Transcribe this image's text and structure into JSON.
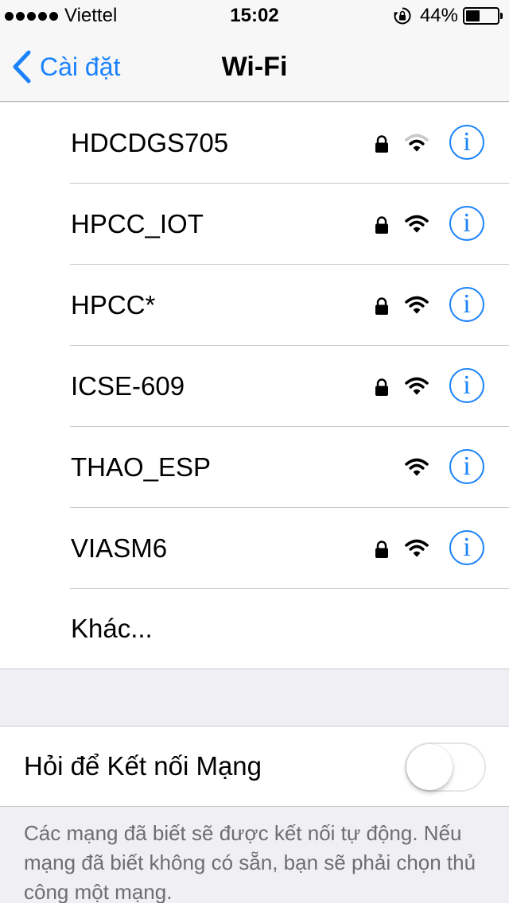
{
  "status_bar": {
    "carrier": "Viettel",
    "time": "15:02",
    "battery_percent": "44%",
    "battery_level": 0.44,
    "icons": [
      "signal-dots-icon",
      "rotation-lock-icon",
      "battery-icon"
    ]
  },
  "nav": {
    "back_label": "Cài đặt",
    "title": "Wi-Fi"
  },
  "networks": [
    {
      "name": "HDCDGS705",
      "secured": true,
      "signal": "weak"
    },
    {
      "name": "HPCC_IOT",
      "secured": true,
      "signal": "full"
    },
    {
      "name": "HPCC*",
      "secured": true,
      "signal": "full"
    },
    {
      "name": "ICSE-609",
      "secured": true,
      "signal": "full"
    },
    {
      "name": "THAO_ESP",
      "secured": false,
      "signal": "full"
    },
    {
      "name": "VIASM6",
      "secured": true,
      "signal": "full"
    }
  ],
  "info_glyph": "i",
  "other_label": "Khác...",
  "ask_to_join": {
    "label": "Hỏi để Kết nối Mạng",
    "enabled": false
  },
  "footer_text": "Các mạng đã biết sẽ được kết nối tự động. Nếu mạng đã biết không có sẵn, bạn sẽ phải chọn thủ công một mạng.",
  "colors": {
    "accent": "#1a82fb",
    "background": "#efeff4",
    "separator": "#c8c7cc",
    "footer_text": "#6d6d72"
  }
}
